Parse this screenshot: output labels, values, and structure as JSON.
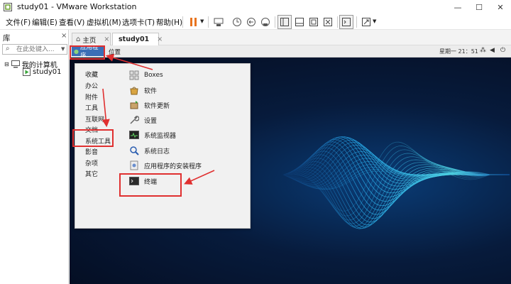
{
  "window": {
    "title": "study01 - VMware Workstation",
    "minimize": "—",
    "maximize": "☐",
    "close": "✕"
  },
  "menubar": {
    "items": [
      "文件(F)",
      "编辑(E)",
      "查看(V)",
      "虚拟机(M)",
      "选项卡(T)",
      "帮助(H)"
    ]
  },
  "library": {
    "title": "库",
    "close": "×",
    "search_placeholder": "在此处键入...",
    "tree": {
      "root": "我的计算机",
      "child": "study01"
    }
  },
  "vm_tabs": [
    {
      "label": "主页",
      "close": "×"
    },
    {
      "label": "study01",
      "close": "×"
    }
  ],
  "gnome_bar": {
    "applications": "应用程序",
    "places": "位置",
    "clock": "星期一 21：51"
  },
  "app_menu": {
    "categories": [
      "收藏",
      "办公",
      "附件",
      "工具",
      "互联网",
      "文档",
      "系统工具",
      "影音",
      "杂项",
      "其它"
    ],
    "items": [
      "Boxes",
      "软件",
      "软件更新",
      "设置",
      "系统监视器",
      "系统日志",
      "应用程序的安装程序",
      "终端"
    ],
    "highlighted_category": "系统工具",
    "highlighted_item": "终端"
  },
  "colors": {
    "annotation": "#e03030",
    "desktop": "#061a3a",
    "wave": "#29b6f6"
  }
}
